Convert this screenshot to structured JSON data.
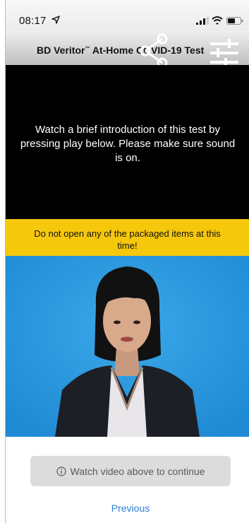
{
  "status_bar": {
    "time": "08:17"
  },
  "header": {
    "title_prefix": "BD Veritor",
    "title_tm": "™",
    "title_suffix": " At-Home COVID-19 Test"
  },
  "intro": {
    "text": "Watch a brief introduction of this test by pressing play below. Please make sure sound is on."
  },
  "warning": {
    "text": "Do not open any of the packaged items at this time!"
  },
  "footer": {
    "continue_label": "Watch video above to continue",
    "previous_label": "Previous"
  },
  "colors": {
    "warning_bg": "#f6c80c",
    "video_bg": "#2b9ce0",
    "link": "#2f7fd6"
  },
  "icons": [
    "location-arrow-icon",
    "signal-icon",
    "wifi-icon",
    "battery-icon",
    "share-icon",
    "filter-icon",
    "info-icon"
  ]
}
